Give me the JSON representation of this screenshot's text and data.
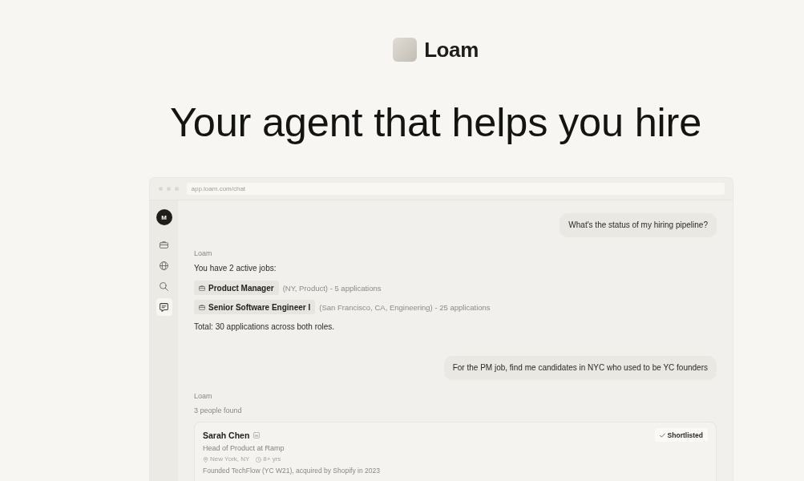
{
  "brand": {
    "name": "Loam"
  },
  "headline": "Your agent that helps you hire",
  "browser": {
    "url": "app.loam.com/chat"
  },
  "sidebar": {
    "avatar": "M",
    "items": [
      {
        "kind": "briefcase",
        "selected": false
      },
      {
        "kind": "globe",
        "selected": false
      },
      {
        "kind": "search",
        "selected": false
      },
      {
        "kind": "chat",
        "selected": true
      }
    ]
  },
  "chat": {
    "messages": [
      {
        "kind": "user",
        "text": "What's the status of my hiring pipeline?"
      },
      {
        "kind": "agent",
        "sender": "Loam",
        "text": "You have 2 active jobs:",
        "jobs": [
          {
            "title": "Product Manager",
            "details": "(NY, Product) - 5 applications"
          },
          {
            "title": "Senior Software Engineer I",
            "details": "(San Francisco, CA, Engineering) - 25 applications"
          }
        ],
        "summary": "Total: 30 applications across both roles."
      },
      {
        "kind": "user",
        "text": "For the PM job, find me candidates in NYC who used to be YC founders"
      },
      {
        "kind": "agent",
        "sender": "Loam",
        "count": "3 people found",
        "candidates": [
          {
            "name": "Sarah Chen",
            "title": "Head of Product at Ramp",
            "location": "New York, NY",
            "experience": "8+ yrs",
            "note": "Founded TechFlow (YC W21), acquired by Shopify in 2023",
            "status": "Shortlisted",
            "shortlisted": true
          }
        ]
      }
    ]
  }
}
